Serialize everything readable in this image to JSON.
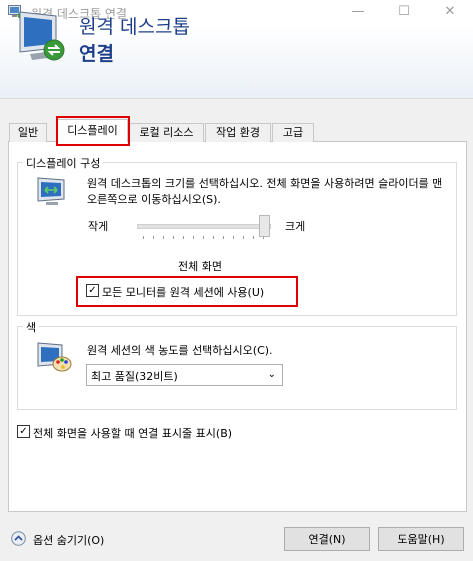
{
  "window": {
    "title": "원격 데스크톱 연결",
    "minimize_glyph": "—",
    "maximize_glyph": "☐",
    "close_glyph": "✕"
  },
  "header": {
    "line1": "원격 데스크톱",
    "line2": "연결",
    "icon": "remote-desktop-monitor-icon"
  },
  "tabs": [
    {
      "label": "일반"
    },
    {
      "label": "디스플레이",
      "selected": true
    },
    {
      "label": "로컬 리소스"
    },
    {
      "label": "작업 환경"
    },
    {
      "label": "고급"
    }
  ],
  "display_config": {
    "group_label": "디스플레이 구성",
    "icon": "display-size-icon",
    "description": "원격 데스크톱의 크기를 선택하십시오. 전체 화면을 사용하려면 슬라이더를 맨 오른쪽으로 이동하십시오(S).",
    "slider_min_label": "작게",
    "slider_max_label": "크게",
    "slider_value_label": "전체 화면",
    "slider_position": 1.0,
    "all_monitors_checkbox": {
      "label": "모든 모니터를 원격 세션에 사용(U)",
      "checked": true
    }
  },
  "color": {
    "group_label": "색",
    "icon": "color-palette-monitor-icon",
    "description": "원격 세션의 색 농도를 선택하십시오(C).",
    "select_value": "최고 품질(32비트)"
  },
  "fullscreen_bar_checkbox": {
    "label": "전체 화면을 사용할 때 연결 표시줄 표시(B)",
    "checked": true
  },
  "footer": {
    "options_toggle": "옵션 숨기기(O)",
    "connect_button": "연결(N)",
    "help_button": "도움말(H)"
  },
  "colors": {
    "header_text": "#1e3f8a",
    "highlight_box": "#e00000"
  }
}
